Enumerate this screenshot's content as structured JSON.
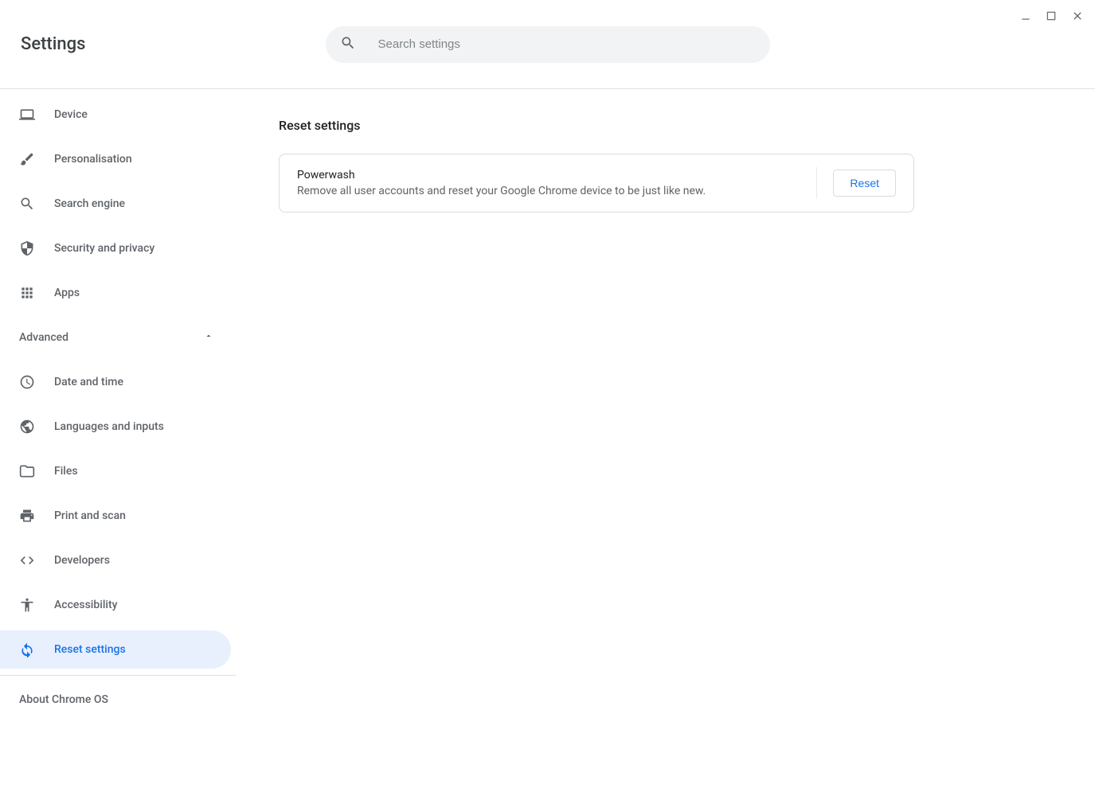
{
  "window": {
    "title": "Settings"
  },
  "search": {
    "placeholder": "Search settings",
    "value": ""
  },
  "sidebar": {
    "items": [
      {
        "label": "Device",
        "icon": "laptop-icon",
        "selected": false
      },
      {
        "label": "Personalisation",
        "icon": "brush-icon",
        "selected": false
      },
      {
        "label": "Search engine",
        "icon": "search-icon",
        "selected": false
      },
      {
        "label": "Security and privacy",
        "icon": "shield-icon",
        "selected": false
      },
      {
        "label": "Apps",
        "icon": "apps-grid-icon",
        "selected": false
      }
    ],
    "advanced_label": "Advanced",
    "advanced_expanded": true,
    "advanced_items": [
      {
        "label": "Date and time",
        "icon": "clock-icon",
        "selected": false
      },
      {
        "label": "Languages and inputs",
        "icon": "globe-icon",
        "selected": false
      },
      {
        "label": "Files",
        "icon": "folder-icon",
        "selected": false
      },
      {
        "label": "Print and scan",
        "icon": "printer-icon",
        "selected": false
      },
      {
        "label": "Developers",
        "icon": "code-icon",
        "selected": false
      },
      {
        "label": "Accessibility",
        "icon": "accessibility-icon",
        "selected": false
      },
      {
        "label": "Reset settings",
        "icon": "reset-icon",
        "selected": true
      }
    ],
    "about_label": "About Chrome OS"
  },
  "main": {
    "section_title": "Reset settings",
    "powerwash": {
      "title": "Powerwash",
      "description": "Remove all user accounts and reset your Google Chrome device to be just like new.",
      "button_label": "Reset"
    }
  }
}
